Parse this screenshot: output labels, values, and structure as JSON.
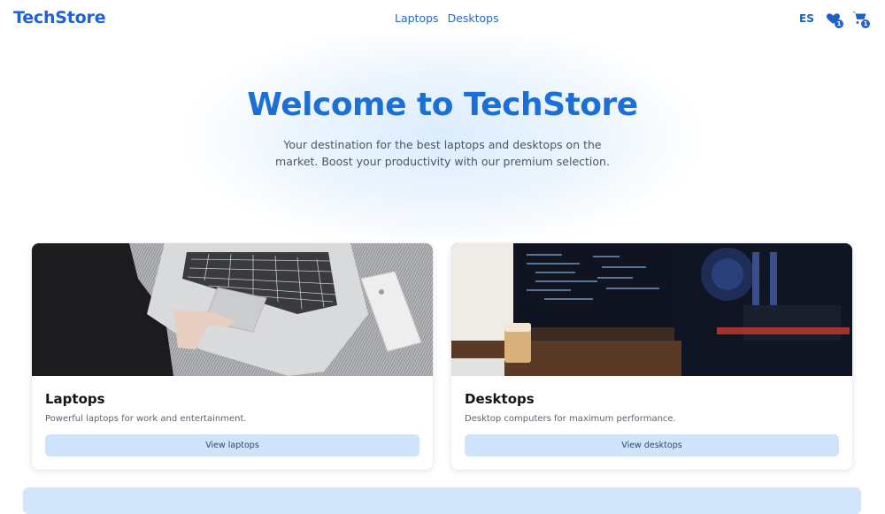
{
  "header": {
    "logo": "TechStore",
    "nav": [
      "Laptops",
      "Desktops"
    ],
    "language": "ES",
    "wishlist_count": "1",
    "cart_count": "1"
  },
  "hero": {
    "title": "Welcome to TechStore",
    "subtitle": "Your destination for the best laptops and desktops on the market. Boost your productivity with our premium selection."
  },
  "categories": [
    {
      "title": "Laptops",
      "description": "Powerful laptops for work and entertainment.",
      "button": "View laptops"
    },
    {
      "title": "Desktops",
      "description": "Desktop computers for maximum performance.",
      "button": "View desktops"
    }
  ],
  "colors": {
    "accent": "#1d63d6",
    "button_bg": "#cfe3fb"
  },
  "icons": [
    "heart-icon",
    "cart-icon"
  ]
}
